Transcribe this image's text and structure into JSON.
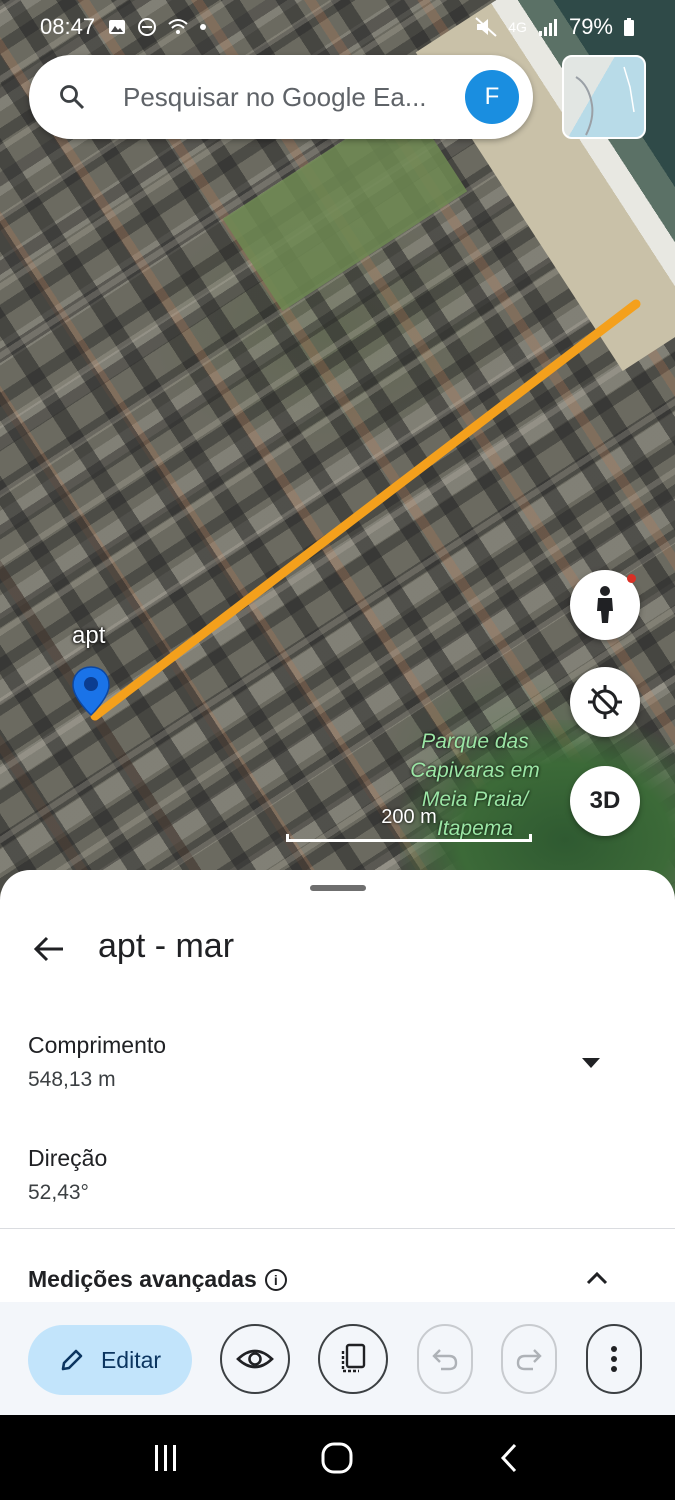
{
  "status_bar": {
    "time": "08:47",
    "network": "4G",
    "battery": "79%"
  },
  "search": {
    "placeholder": "Pesquisar no Google Ea...",
    "avatar_letter": "F"
  },
  "map": {
    "pin_label": "apt",
    "park_label": "Parque das Capivaras em Meia Praia/ Itapema",
    "scale_label": "200 m",
    "three_d_label": "3D",
    "path_color": "#f4a01c"
  },
  "sheet": {
    "title": "apt - mar",
    "length_label": "Comprimento",
    "length_value": "548,13 m",
    "direction_label": "Direção",
    "direction_value": "52,43°",
    "advanced_label": "Medições avançadas"
  },
  "toolbar": {
    "edit_label": "Editar"
  }
}
